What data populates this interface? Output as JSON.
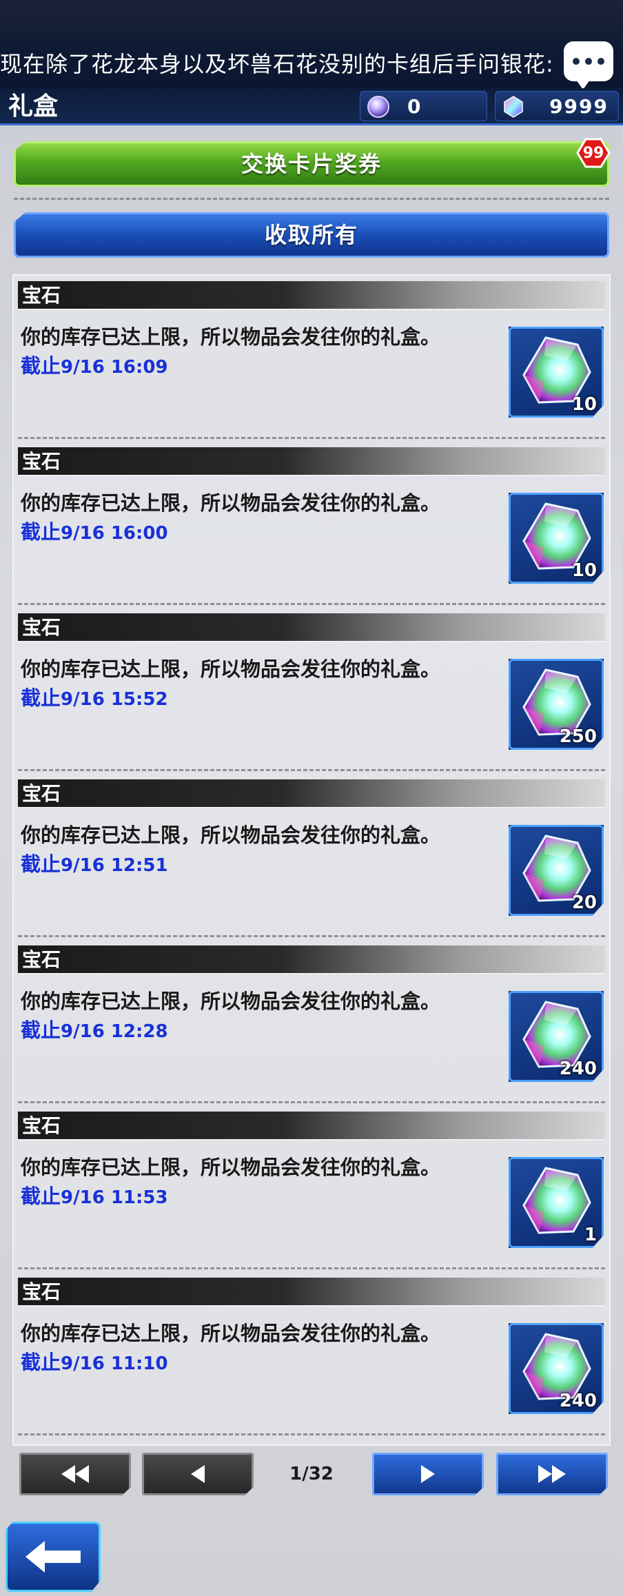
{
  "ticker": {
    "text": "现在除了花龙本身以及坏兽石花没别的卡组后手问银花:"
  },
  "header": {
    "title": "礼盒"
  },
  "currency": {
    "orb_value": "0",
    "gem_value": "9999"
  },
  "buttons": {
    "exchange_label": "交换卡片奖券",
    "exchange_badge": "99",
    "receive_all_label": "收取所有"
  },
  "deadline_label": "截止",
  "items": [
    {
      "category": "宝石",
      "message": "你的库存已达上限，所以物品会发往你的礼盒。",
      "deadline": "9/16 16:09",
      "quantity": "10"
    },
    {
      "category": "宝石",
      "message": "你的库存已达上限，所以物品会发往你的礼盒。",
      "deadline": "9/16 16:00",
      "quantity": "10"
    },
    {
      "category": "宝石",
      "message": "你的库存已达上限，所以物品会发往你的礼盒。",
      "deadline": "9/16 15:52",
      "quantity": "250"
    },
    {
      "category": "宝石",
      "message": "你的库存已达上限，所以物品会发往你的礼盒。",
      "deadline": "9/16 12:51",
      "quantity": "20"
    },
    {
      "category": "宝石",
      "message": "你的库存已达上限，所以物品会发往你的礼盒。",
      "deadline": "9/16 12:28",
      "quantity": "240"
    },
    {
      "category": "宝石",
      "message": "你的库存已达上限，所以物品会发往你的礼盒。",
      "deadline": "9/16 11:53",
      "quantity": "1"
    },
    {
      "category": "宝石",
      "message": "你的库存已达上限，所以物品会发往你的礼盒。",
      "deadline": "9/16 11:10",
      "quantity": "240"
    }
  ],
  "pager": {
    "page_indicator": "1/32"
  },
  "icons": {
    "chat": "chat-bubble-icon",
    "orb": "orb-icon",
    "gem": "gem-icon",
    "first": "double-left-arrow-icon",
    "prev": "left-arrow-icon",
    "next": "right-arrow-icon",
    "last": "double-right-arrow-icon",
    "back": "back-arrow-icon"
  },
  "colors": {
    "deadline": "#1830d8",
    "accent_blue": "#1b4fb8",
    "accent_green": "#52a820",
    "badge_red": "#e01818"
  }
}
